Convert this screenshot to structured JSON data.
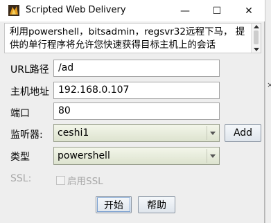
{
  "window": {
    "title": "Scripted Web Delivery",
    "controls": {
      "minimize": "—",
      "maximize": "☐",
      "close": "✕"
    }
  },
  "description": "利用powershell，bitsadmin，regsvr32远程下马， 提供的单行程序将允许您快速获得目标主机上的会话",
  "form": {
    "url_path": {
      "label": "URL路径",
      "value": "/ad"
    },
    "host": {
      "label": "主机地址",
      "value": "192.168.0.107"
    },
    "port": {
      "label": "端口",
      "value": "80"
    },
    "listener": {
      "label": "监听器:",
      "value": "ceshi1",
      "add_label": "Add"
    },
    "type": {
      "label": "类型",
      "value": "powershell"
    },
    "ssl": {
      "label": "SSL:",
      "checkbox_label": "启用SSL",
      "checked": false
    }
  },
  "buttons": {
    "start": "开始",
    "help": "帮助"
  },
  "background_fragment": "×"
}
